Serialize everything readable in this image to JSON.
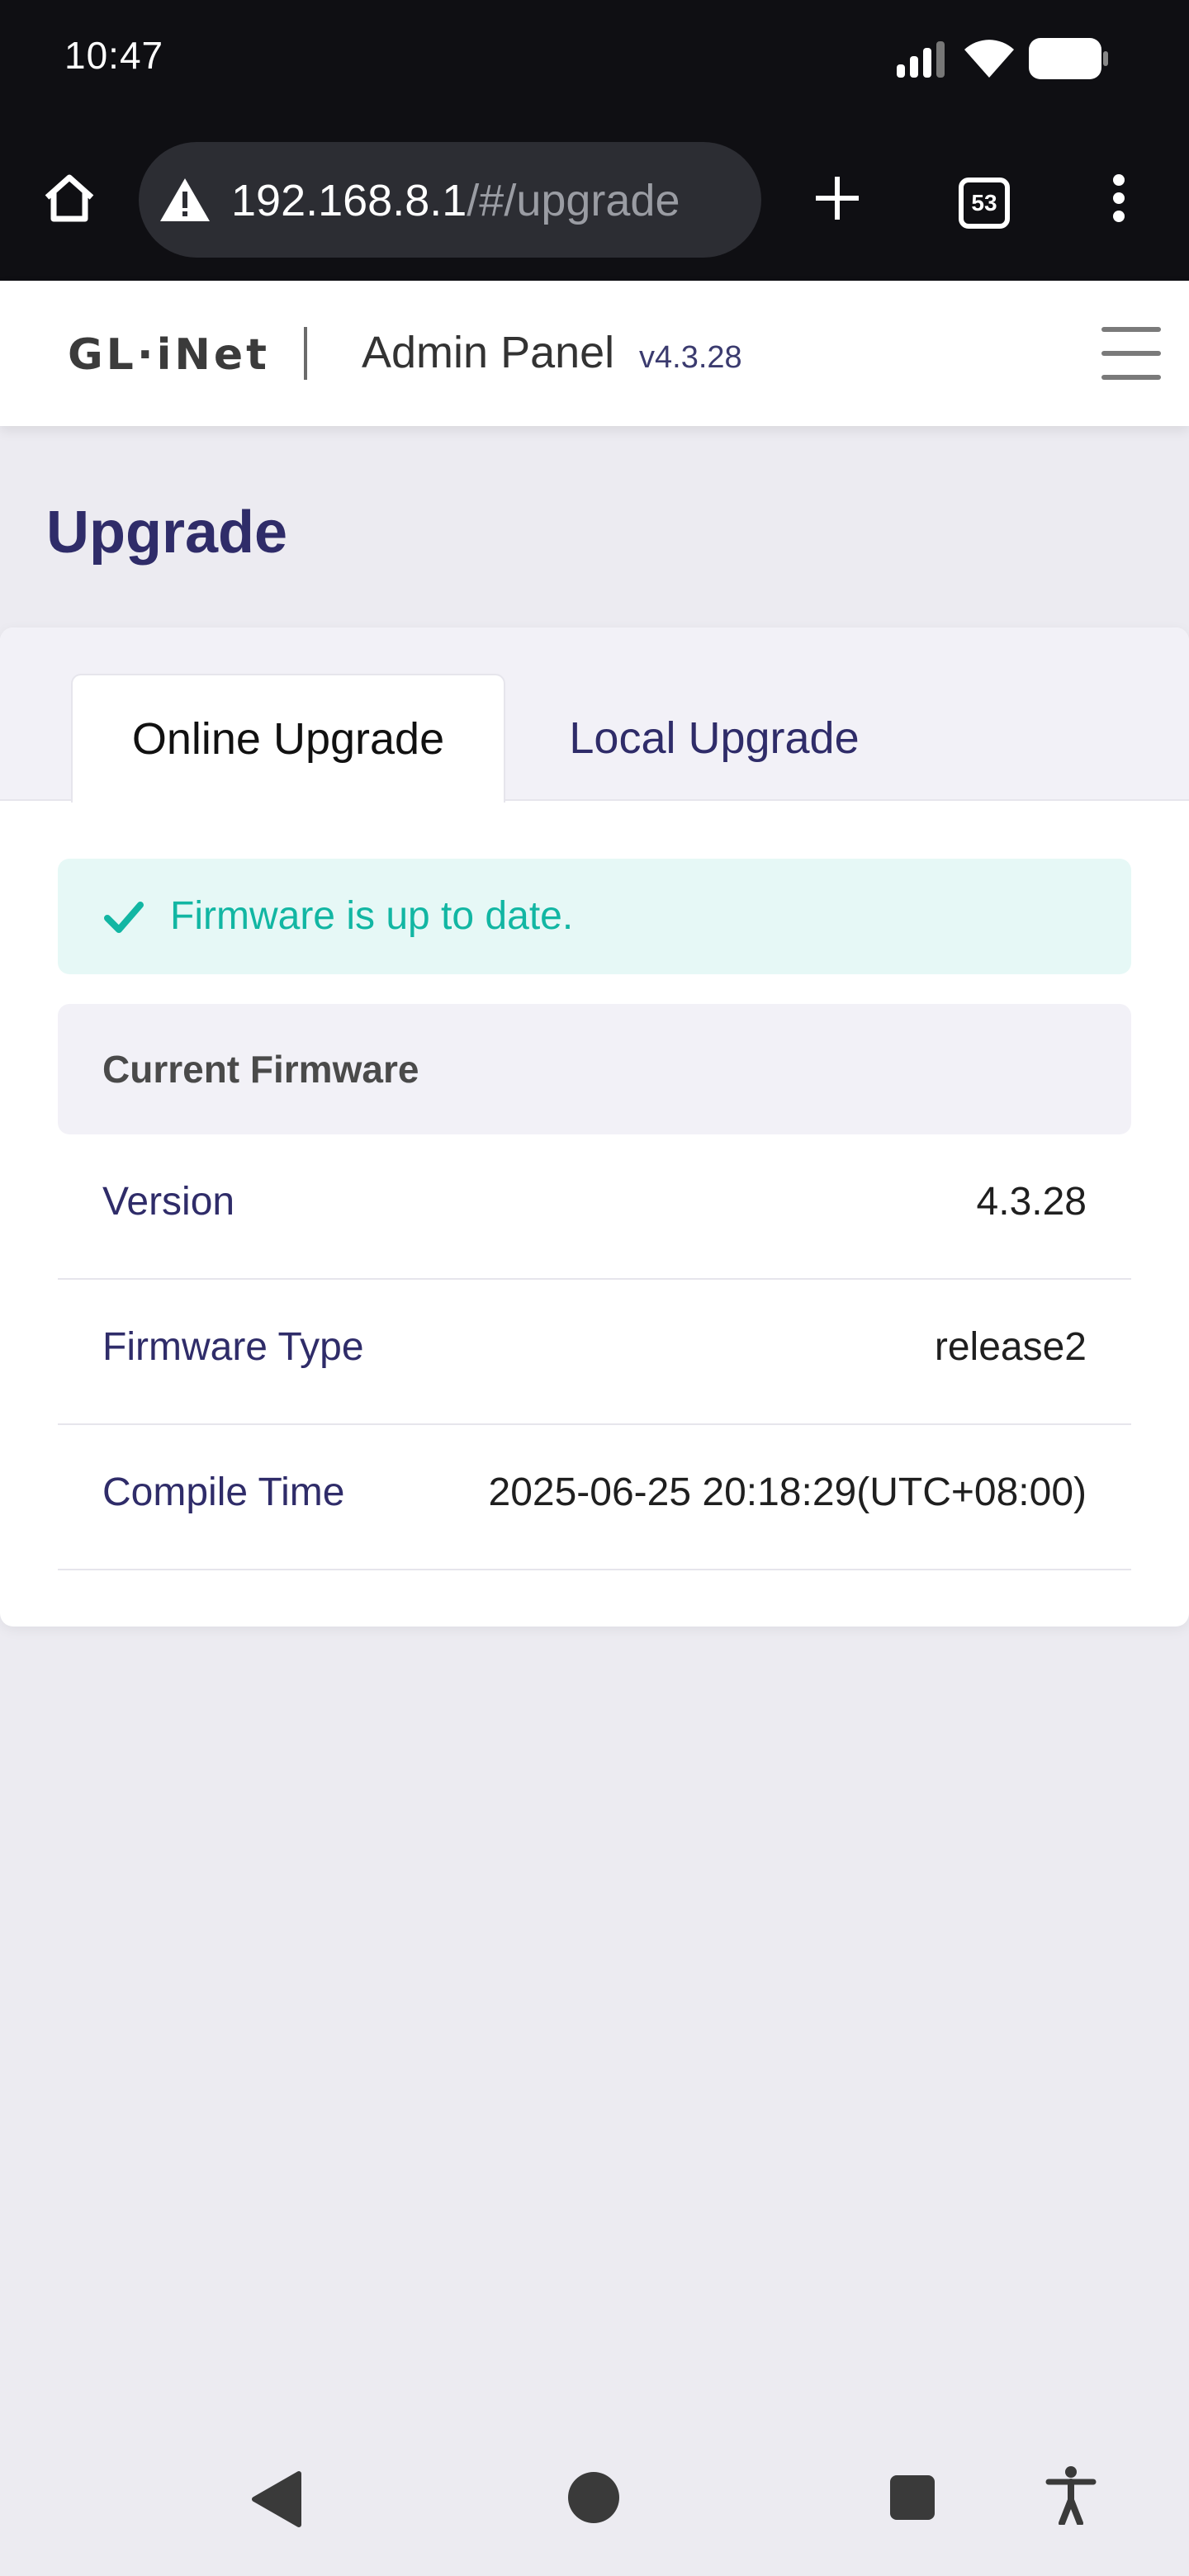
{
  "status_bar": {
    "time": "10:47"
  },
  "browser": {
    "url_host": "192.168.8.1",
    "url_path": "/#/upgrade",
    "tab_count": "53"
  },
  "header": {
    "logo_text": "GL·iNet",
    "panel_title": "Admin Panel",
    "panel_version": "v4.3.28"
  },
  "page": {
    "title": "Upgrade"
  },
  "tabs": [
    {
      "label": "Online Upgrade",
      "active": true
    },
    {
      "label": "Local Upgrade",
      "active": false
    }
  ],
  "alert": {
    "message": "Firmware is up to date."
  },
  "firmware": {
    "section_title": "Current Firmware",
    "rows": [
      {
        "label": "Version",
        "value": "4.3.28"
      },
      {
        "label": "Firmware Type",
        "value": "release2"
      },
      {
        "label": "Compile Time",
        "value": "2025-06-25 20:18:29(UTC+08:00)"
      }
    ]
  },
  "colors": {
    "accent": "#2f2c69",
    "success": "#12b6a3",
    "background": "#ecebf1"
  }
}
